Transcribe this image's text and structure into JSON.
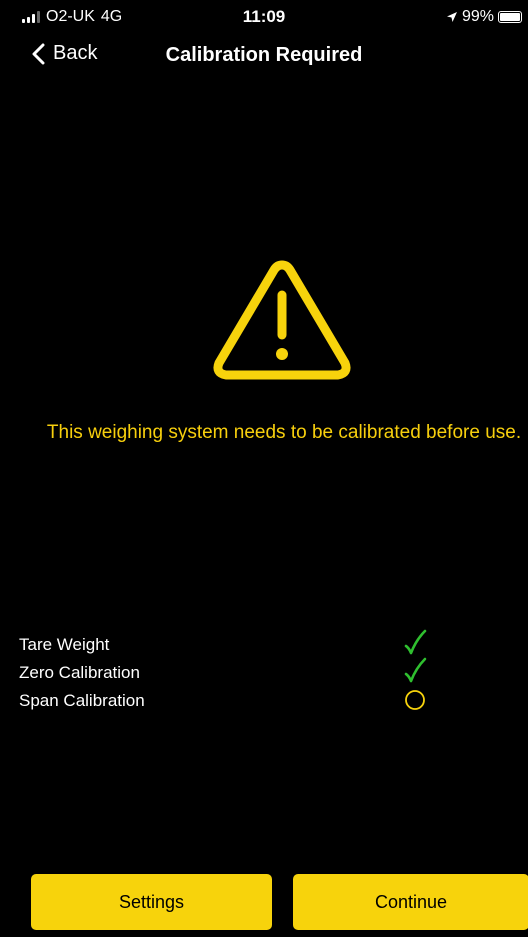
{
  "status_bar": {
    "carrier": "O2-UK",
    "network": "4G",
    "time": "11:09",
    "battery": "99%",
    "battery_level": 0.99
  },
  "nav": {
    "back_label": "Back",
    "title": "Calibration Required"
  },
  "warning": {
    "icon": "warning-triangle-icon",
    "message": "This weighing system needs to be calibrated before use."
  },
  "checklist": {
    "items": [
      {
        "label": "Tare Weight",
        "status": "done"
      },
      {
        "label": "Zero Calibration",
        "status": "done"
      },
      {
        "label": "Span Calibration",
        "status": "pending"
      }
    ]
  },
  "buttons": {
    "settings_label": "Settings",
    "continue_label": "Continue"
  },
  "colors": {
    "accent": "#f7d30c",
    "warning_text": "#f7cf0d",
    "check_green": "#2fbf2f",
    "background": "#000000"
  }
}
